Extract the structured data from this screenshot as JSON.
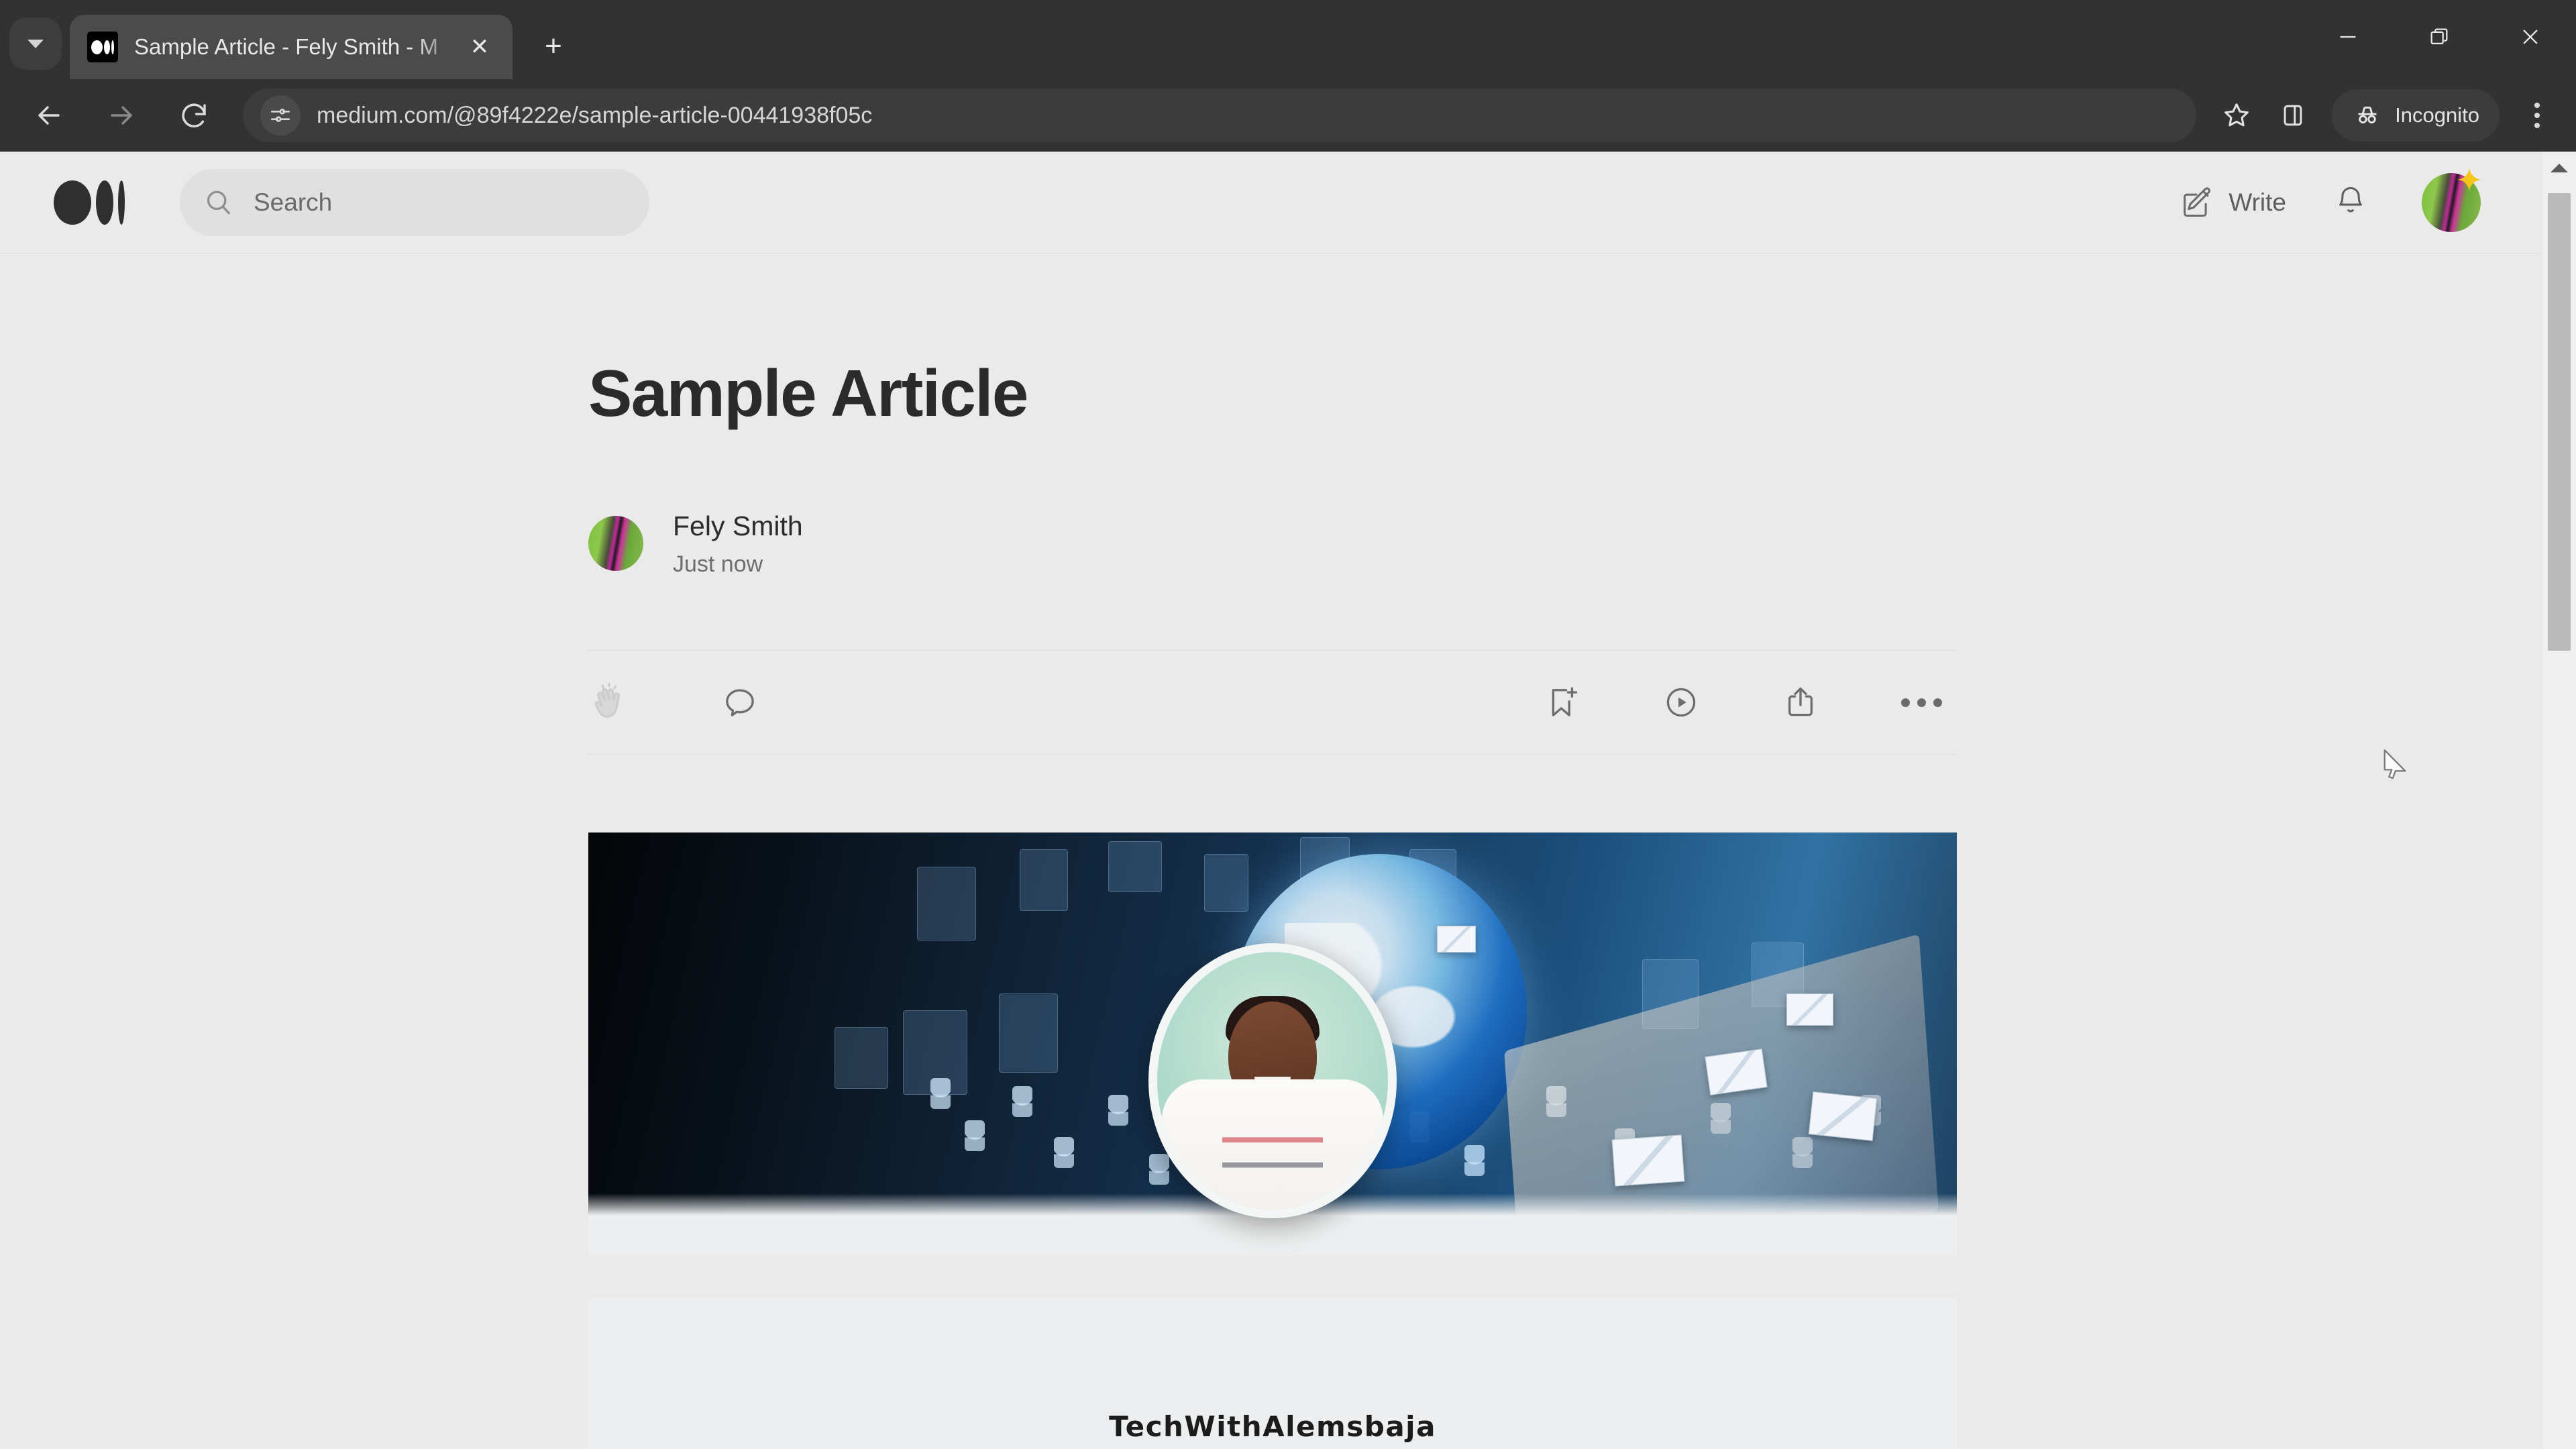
{
  "browser": {
    "tab": {
      "title": "Sample Article - Fely Smith - M",
      "favicon_name": "medium-favicon",
      "close_label": "✕"
    },
    "tab_search_label": "search-tabs",
    "new_tab_label": "+",
    "window_controls": {
      "minimize": "—",
      "restore": "❐",
      "close": "✕"
    },
    "toolbar": {
      "back_label": "←",
      "forward_label": "→",
      "reload_label": "↻",
      "url": "medium.com/@89f4222e/sample-article-00441938f05c",
      "site_info_icon": "page-info-icon",
      "bookmark_icon": "star-icon",
      "sidepanel_icon": "side-panel-icon",
      "incognito_label": "Incognito",
      "menu_icon": "three-dot-menu-icon"
    }
  },
  "site_header": {
    "logo_name": "medium-logo",
    "search_placeholder": "Search",
    "write_label": "Write",
    "notifications_icon": "bell-icon",
    "avatar_name": "user-avatar",
    "avatar_badge_icon": "star-badge-icon"
  },
  "article": {
    "title": "Sample Article",
    "author": "Fely Smith",
    "published": "Just now",
    "actions": {
      "clap_label": "clap-icon",
      "comment_label": "comment-icon",
      "bookmark_label": "bookmark-add-icon",
      "listen_label": "play-circle-icon",
      "share_label": "share-icon",
      "more_label": "more-options-icon"
    },
    "hero": {
      "alt": "Global digital network with social media icons, world globe and a circular portrait",
      "caption": "TechWithAlemsbaja"
    }
  },
  "scrollbar": {
    "up_arrow": "scroll-up-arrow"
  }
}
